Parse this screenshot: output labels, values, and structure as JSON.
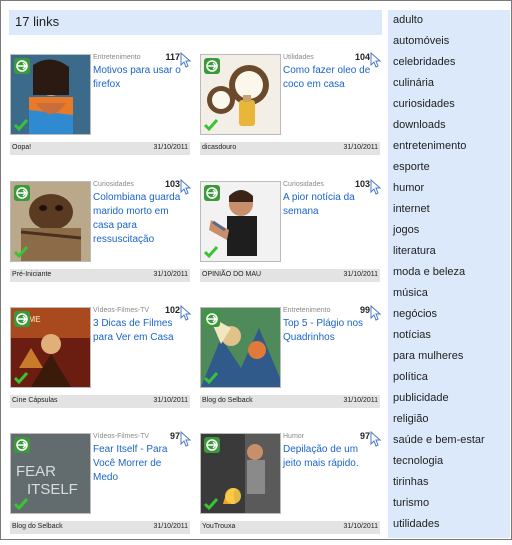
{
  "header": {
    "title": "17 links"
  },
  "sidebar": {
    "items": [
      "adulto",
      "automóveis",
      "celebridades",
      "culinária",
      "curiosidades",
      "downloads",
      "entretenimento",
      "esporte",
      "humor",
      "internet",
      "jogos",
      "literatura",
      "moda e beleza",
      "música",
      "negócios",
      "notícias",
      "para mulheres",
      "política",
      "publicidade",
      "religião",
      "saúde e bem-estar",
      "tecnologia",
      "tirinhas",
      "turismo",
      "utilidades"
    ]
  },
  "cards": [
    {
      "category": "Entretenimento",
      "count": "117",
      "title": "Motivos para usar o firefox",
      "source": "Oopa!",
      "date": "31/10/2011"
    },
    {
      "category": "Utilidades",
      "count": "104",
      "title": "Como fazer oleo de coco em casa",
      "source": "dicasdouro",
      "date": "31/10/2011"
    },
    {
      "category": "Curiosidades",
      "count": "103",
      "title": "Colombiana guarda marido morto em casa para ressuscitação",
      "source": "Pré-Iniciante",
      "date": "31/10/2011"
    },
    {
      "category": "Curiosidades",
      "count": "103",
      "title": "A pior notícia da semana",
      "source": "OPINIÃO DO MAU",
      "date": "31/10/2011"
    },
    {
      "category": "Vídeos-Filmes-TV",
      "count": "102",
      "title": "3 Dicas de Filmes para Ver em Casa",
      "source": "Cine Cápsulas",
      "date": "31/10/2011"
    },
    {
      "category": "Entretenimento",
      "count": "99",
      "title": "Top 5 - Plágio nos Quadrinhos",
      "source": "Blog do Selback",
      "date": "31/10/2011"
    },
    {
      "category": "Vídeos-Filmes-TV",
      "count": "97",
      "title": "Fear Itself - Para Você Morrer de Medo",
      "source": "Blog do Selback",
      "date": "31/10/2011"
    },
    {
      "category": "Humor",
      "count": "97",
      "title": "Depilação de um jeito mais rápido.",
      "source": "YouTrouxa",
      "date": "31/10/2011"
    }
  ],
  "colors": {
    "accent": "#dce9fb",
    "link": "#1a64c8",
    "badge": "#3a9a3a"
  }
}
